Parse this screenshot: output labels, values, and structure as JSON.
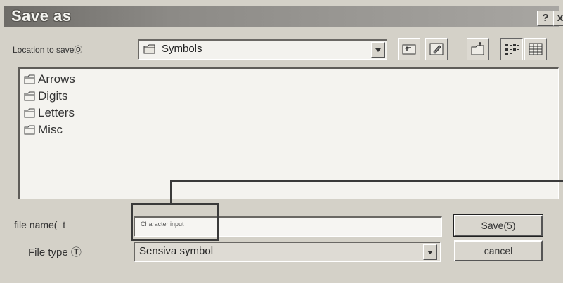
{
  "dialog": {
    "title": "Save as",
    "help_label": "?",
    "close_label": "x"
  },
  "location": {
    "label": "Location to saveⓄ",
    "value": "Symbols"
  },
  "toolbar": {
    "icons": [
      "up-folder-icon",
      "desktop-icon",
      "new-folder-icon",
      "list-view-icon",
      "details-view-icon"
    ]
  },
  "file_list": {
    "items": [
      {
        "label": "Arrows",
        "icon": "folder-icon"
      },
      {
        "label": "Digits",
        "icon": "folder-icon"
      },
      {
        "label": "Letters",
        "icon": "folder-icon"
      },
      {
        "label": "Misc",
        "icon": "folder-icon"
      }
    ]
  },
  "file_name": {
    "label": "file name(_t",
    "value": "Character input"
  },
  "file_type": {
    "label": "File type Ⓣ",
    "value": "Sensiva symbol"
  },
  "buttons": {
    "save_label": "Save(5)",
    "cancel_label": "cancel"
  },
  "colors": {
    "dialog_bg": "#d4d1c8",
    "titlebar": "#8c8a86",
    "field_bg": "#f4f3ef"
  }
}
